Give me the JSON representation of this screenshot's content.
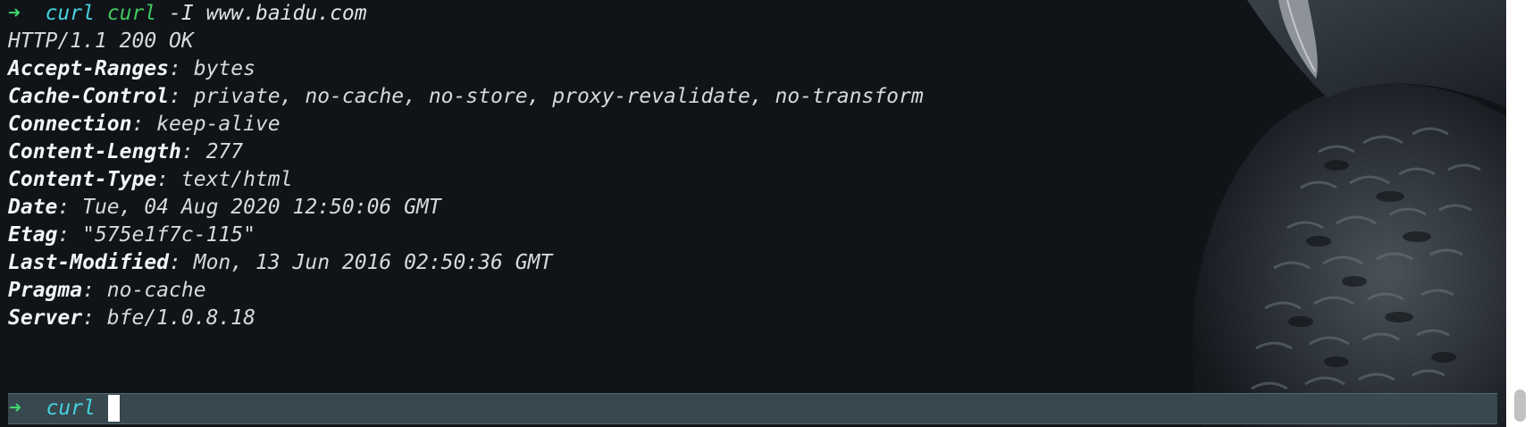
{
  "colors": {
    "background": "#101419",
    "prompt_arrow": "#3fd66f",
    "command_cyan": "#45d2de",
    "command_green": "#41c95c",
    "prompt_bar": "#37484f"
  },
  "prompt_symbol": "➜",
  "executed_command": {
    "alias": "curl",
    "program": "curl",
    "arguments": " -I www.baidu.com"
  },
  "status_line": "HTTP/1.1 200 OK",
  "headers": [
    {
      "key": "Accept-Ranges",
      "value": "bytes"
    },
    {
      "key": "Cache-Control",
      "value": "private, no-cache, no-store, proxy-revalidate, no-transform"
    },
    {
      "key": "Connection",
      "value": "keep-alive"
    },
    {
      "key": "Content-Length",
      "value": "277"
    },
    {
      "key": "Content-Type",
      "value": "text/html"
    },
    {
      "key": "Date",
      "value": "Tue, 04 Aug 2020 12:50:06 GMT"
    },
    {
      "key": "Etag",
      "value": "\"575e1f7c-115\""
    },
    {
      "key": "Last-Modified",
      "value": "Mon, 13 Jun 2016 02:50:36 GMT"
    },
    {
      "key": "Pragma",
      "value": "no-cache"
    },
    {
      "key": "Server",
      "value": "bfe/1.0.8.18"
    }
  ],
  "header_separator": ": ",
  "current_input": "curl",
  "background_image_icon": "owl-illustration"
}
